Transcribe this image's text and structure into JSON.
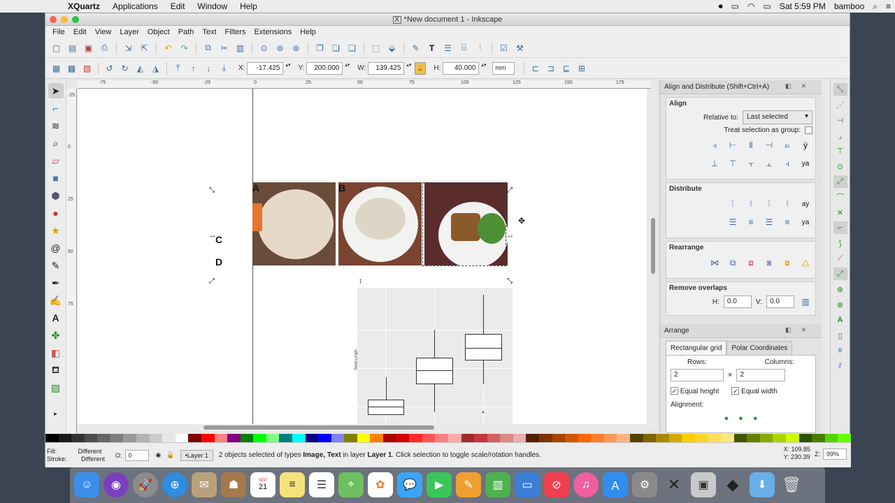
{
  "menubar": {
    "app": "XQuartz",
    "items": [
      "Applications",
      "Edit",
      "Window",
      "Help"
    ],
    "clock": "Sat 5:59 PM",
    "user": "bamboo"
  },
  "window": {
    "title": "*New document 1 - Inkscape"
  },
  "menus": [
    "File",
    "Edit",
    "View",
    "Layer",
    "Object",
    "Path",
    "Text",
    "Filters",
    "Extensions",
    "Help"
  ],
  "controls": {
    "x_label": "X:",
    "x_value": "-17.425",
    "y_label": "Y:",
    "y_value": "200.000",
    "w_label": "W:",
    "w_value": "139.425",
    "h_label": "H:",
    "h_value": "40.000",
    "unit": "mm"
  },
  "ruler": {
    "h_ticks": [
      "-75",
      "-50",
      "-25",
      "0",
      "25",
      "50",
      "75",
      "100",
      "125",
      "150",
      "175"
    ],
    "v_ticks": [
      "-25",
      "0",
      "25",
      "50",
      "75"
    ]
  },
  "canvas": {
    "labels": [
      "A",
      "B",
      "C",
      "D"
    ],
    "chart_ylabel": "Sepal.Length"
  },
  "align_panel": {
    "title": "Align and Distribute (Shift+Ctrl+A)",
    "align_heading": "Align",
    "relative_to_label": "Relative to:",
    "relative_to_value": "Last selected",
    "treat_group_label": "Treat selection as group:",
    "distribute_heading": "Distribute",
    "rearrange_heading": "Rearrange",
    "remove_overlaps_heading": "Remove overlaps",
    "h_label": "H:",
    "h_value": "0.0",
    "v_label": "V:",
    "v_value": "0.0"
  },
  "arrange_panel": {
    "title": "Arrange",
    "tab_grid": "Rectangular grid",
    "tab_polar": "Polar Coordinates",
    "rows_label": "Rows:",
    "rows_value": "2",
    "columns_label": "Columns:",
    "columns_value": "2",
    "times": "×",
    "equal_height": "Equal height",
    "equal_width": "Equal width",
    "alignment_label": "Alignment:"
  },
  "status": {
    "fill_label": "Fill:",
    "fill_value": "Different",
    "stroke_label": "Stroke:",
    "stroke_value": "Different",
    "opacity_label": "O:",
    "opacity_value": "0",
    "layer": "•Layer 1",
    "message_prefix": "2 objects selected of types ",
    "message_types": "Image, Text",
    "message_mid": " in layer ",
    "message_layer": "Layer 1",
    "message_suffix": ". Click selection to toggle scale/rotation handles.",
    "x_label": "X:",
    "x_value": "109.85",
    "y_label": "Y:",
    "y_value": "230.39",
    "zoom_label": "Z:",
    "zoom_value": "99%"
  },
  "dock": {
    "date_month": "SEP",
    "date_day": "21"
  }
}
